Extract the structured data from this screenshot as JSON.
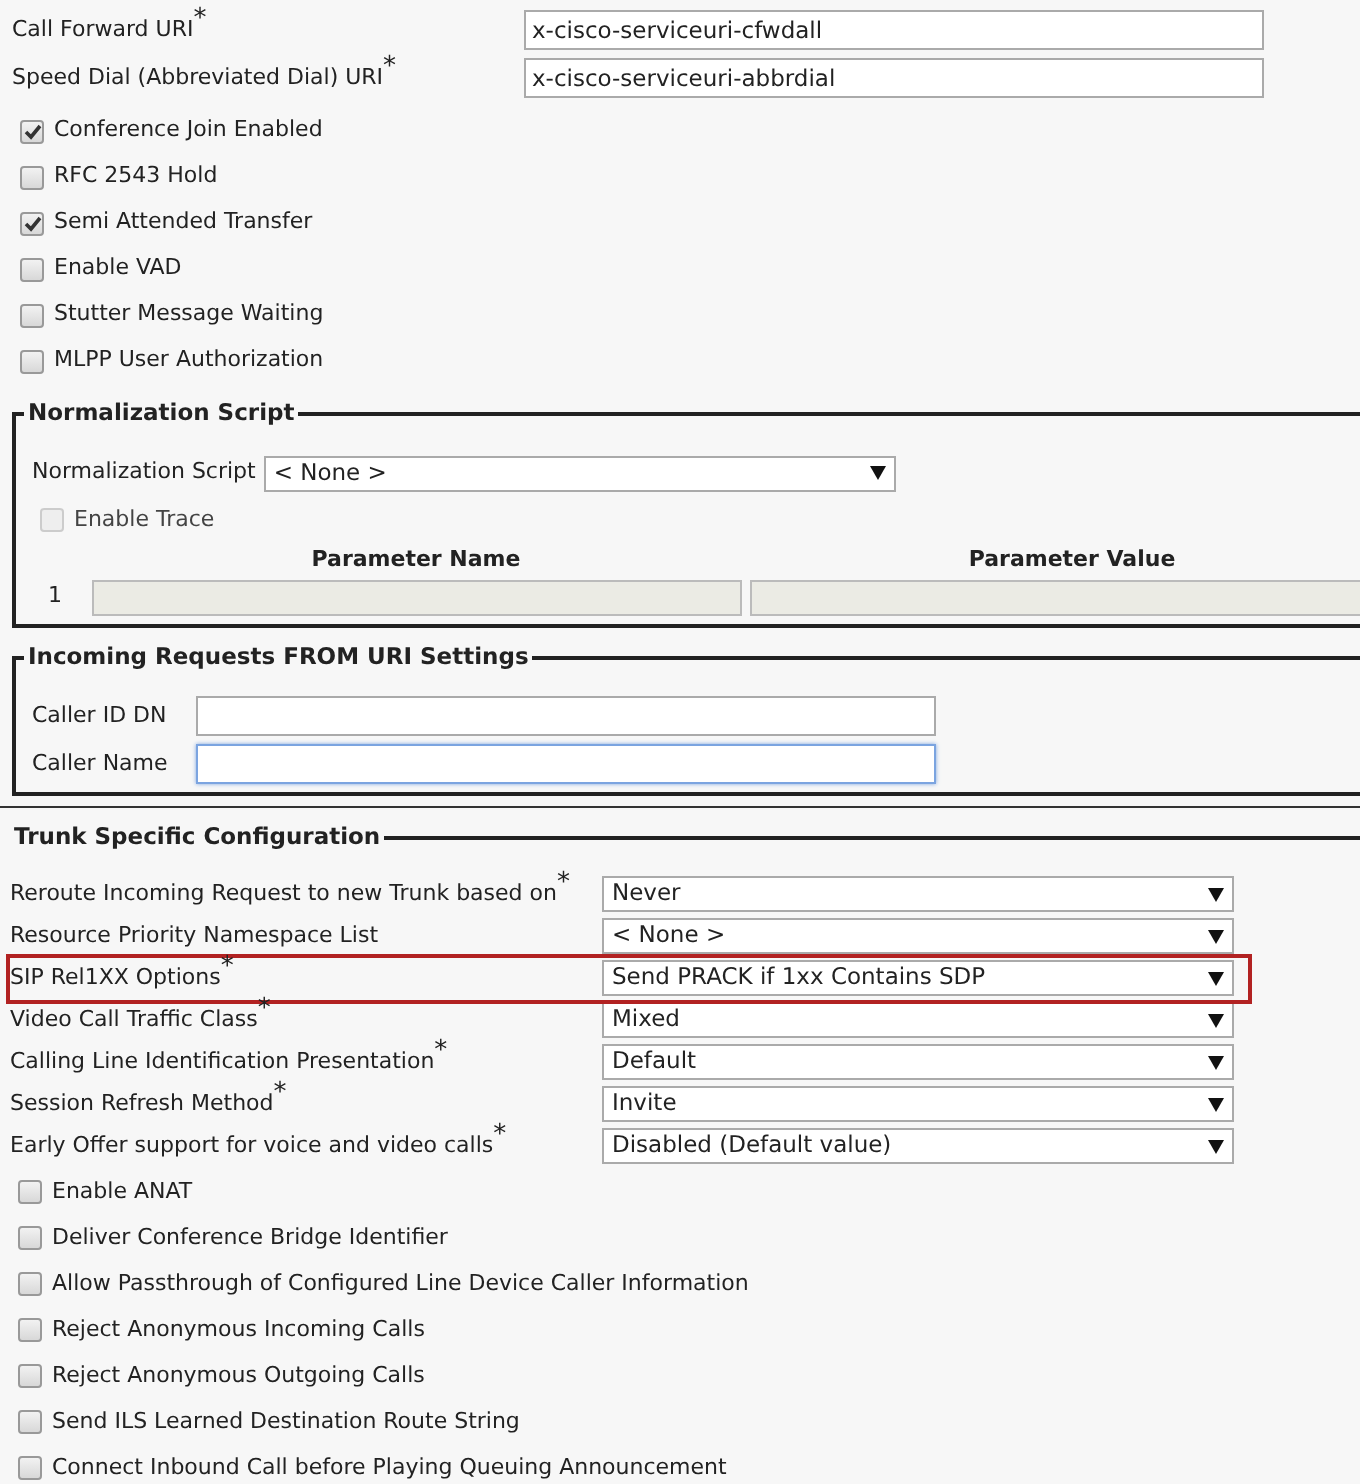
{
  "uri_fields": [
    {
      "label": "Call Forward URI$^{*}$",
      "value": "x-cisco-serviceuri-cfwdall"
    },
    {
      "label": "Speed Dial (Abbreviated Dial) URI$^{*}$",
      "value": "x-cisco-serviceuri-abbrdial"
    }
  ],
  "options": [
    {
      "label": "Conference Join Enabled",
      "checked": true
    },
    {
      "label": "RFC 2543 Hold",
      "checked": false
    },
    {
      "label": "Semi Attended Transfer",
      "checked": true
    },
    {
      "label": "Enable VAD",
      "checked": false
    },
    {
      "label": "Stutter Message Waiting",
      "checked": false
    },
    {
      "label": "MLPP User Authorization",
      "checked": false
    }
  ],
  "normalization": {
    "legend": "Normalization Script",
    "script_label": "Normalization Script",
    "script_value": "< None >",
    "enable_trace": {
      "label": "Enable Trace",
      "checked": false,
      "disabled": true
    },
    "columns": [
      "Parameter Name",
      "Parameter Value"
    ],
    "rows": [
      {
        "index": "1",
        "disabled": true
      }
    ]
  },
  "incoming": {
    "legend": "Incoming Requests FROM URI Settings",
    "fields": [
      {
        "label": "Caller ID DN",
        "focused": false
      },
      {
        "label": "Caller Name",
        "focused": true
      }
    ]
  },
  "trunk": {
    "legend": "Trunk Specific Configuration",
    "settings": [
      {
        "label": "Reroute Incoming Request to new Trunk based on$^{*}$",
        "value": "Never",
        "highlighted": false
      },
      {
        "label": "Resource Priority Namespace List",
        "value": "< None >",
        "highlighted": false
      },
      {
        "label": "SIP Rel1XX Options$^{*}$",
        "value": "Send PRACK if 1xx Contains SDP",
        "highlighted": true
      },
      {
        "label": "Video Call Traffic Class$^{*}$",
        "value": "Mixed",
        "highlighted": false
      },
      {
        "label": "Calling Line Identification Presentation$^{*}$",
        "value": "Default",
        "highlighted": false
      },
      {
        "label": "Session Refresh Method$^{*}$",
        "value": "Invite",
        "highlighted": false
      },
      {
        "label": "Early Offer support for voice and video calls$^{*}$",
        "value": "Disabled (Default value)",
        "highlighted": false
      }
    ],
    "options": [
      {
        "label": "Enable ANAT",
        "checked": false
      },
      {
        "label": "Deliver Conference Bridge Identifier",
        "checked": false
      },
      {
        "label": "Allow Passthrough of Configured Line Device Caller Information",
        "checked": false
      },
      {
        "label": "Reject Anonymous Incoming Calls",
        "checked": false
      },
      {
        "label": "Reject Anonymous Outgoing Calls",
        "checked": false
      },
      {
        "label": "Send ILS Learned Destination Route String",
        "checked": false
      },
      {
        "label": "Connect Inbound Call before Playing Queuing Announcement",
        "checked": false
      }
    ]
  }
}
